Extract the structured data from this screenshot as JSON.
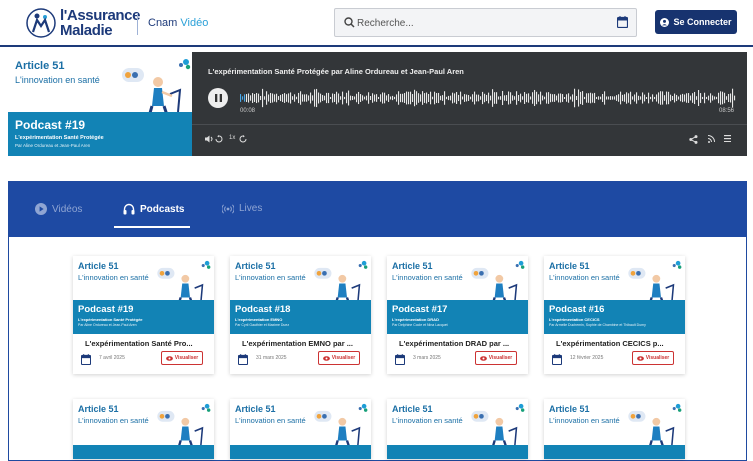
{
  "header": {
    "logo_line1": "l'Assurance",
    "logo_line2": "Maladie",
    "cnam_prefix": "Cnam",
    "cnam_suffix": "Vidéo",
    "search_placeholder": "Recherche...",
    "connect_label": "Se Connecter"
  },
  "banner": {
    "article": "Article 51",
    "subtitle": "L'innovation en santé",
    "podcast_number": "Podcast #19",
    "podcast_title": "L'expérimentation Santé Protégée",
    "podcast_authors": "Par Aline Ordureau et Jean-Paul Aren"
  },
  "player": {
    "title": "L'expérimentation Santé Protégée par Aline Ordureau et Jean-Paul Aren",
    "current_time": "00:08",
    "duration": "08:56",
    "speed": "1x"
  },
  "tabs": [
    {
      "label": "Vidéos",
      "icon": "play-circle-icon",
      "active": false
    },
    {
      "label": "Podcasts",
      "icon": "headphones-icon",
      "active": true
    },
    {
      "label": "Lives",
      "icon": "broadcast-icon",
      "active": false
    }
  ],
  "cards": [
    {
      "number": "Podcast #19",
      "band_title": "L'expérimentation Santé Protégée",
      "band_authors": "Par Aline Ordureau et Jean-Paul Aren",
      "title": "L'expérimentation Santé Pro...",
      "date": "7 avril 2025",
      "button": "Visualiser"
    },
    {
      "number": "Podcast #18",
      "band_title": "L'expérimentation EMNO",
      "band_authors": "Par Cyril Gauthier et Maxime Duez",
      "title": "L'expérimentation EMNO par ...",
      "date": "31 mars 2025",
      "button": "Visualiser"
    },
    {
      "number": "Podcast #17",
      "band_title": "L'expérimentation DRAD",
      "band_authors": "Par Delphine Cocle et Nina Lacquet",
      "title": "L'expérimentation DRAD par ...",
      "date": "3 mars 2025",
      "button": "Visualiser"
    },
    {
      "number": "Podcast #16",
      "band_title": "L'expérimentation CECICS",
      "band_authors": "Par Armelle Duchemin, Sophie de Chambine et Thibault Dumy",
      "title": "L'expérimentation CECICS p...",
      "date": "12 février 2025",
      "button": "Visualiser"
    }
  ],
  "card_article": "Article 51",
  "card_subtitle": "L'innovation en santé",
  "colors": {
    "brand": "#1d3a7a",
    "tabbar": "#1e4aa3",
    "band": "#1283b5",
    "player": "#333639",
    "accent_red": "#cc3333"
  }
}
